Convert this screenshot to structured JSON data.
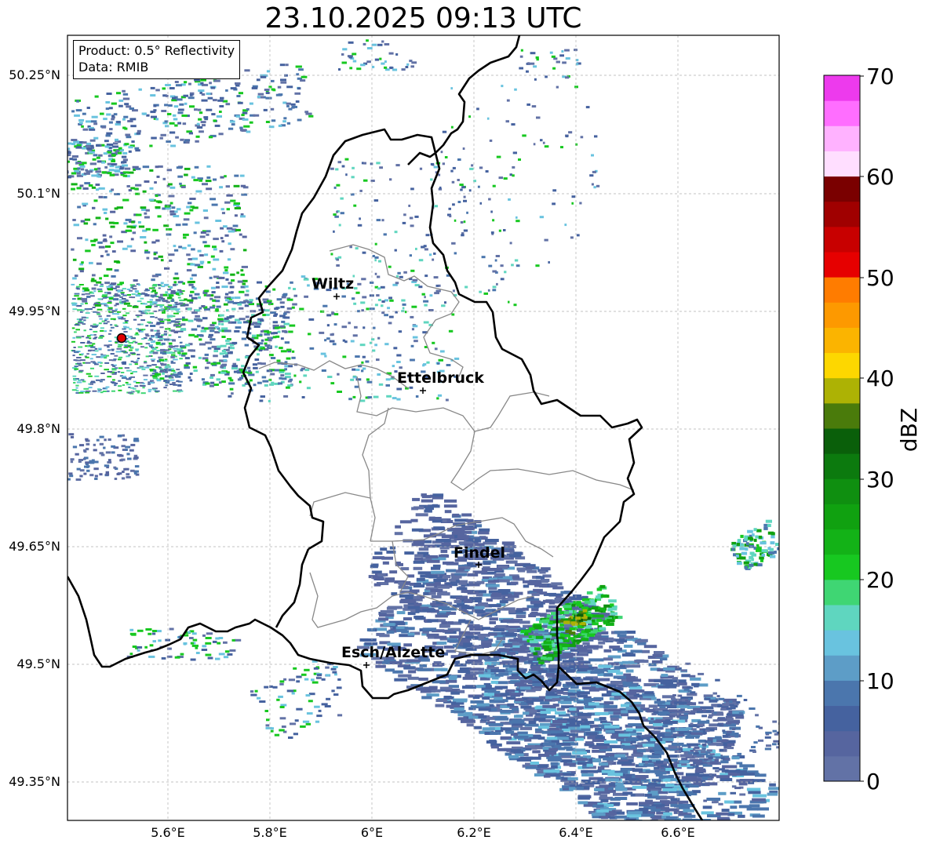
{
  "title": "23.10.2025 09:13 UTC",
  "info_box": {
    "product": "Product: 0.5° Reflectivity",
    "data": "Data: RMIB"
  },
  "map": {
    "lat_ticks": [
      "50.25°N",
      "50.1°N",
      "49.95°N",
      "49.8°N",
      "49.65°N",
      "49.5°N",
      "49.35°N"
    ],
    "lon_ticks": [
      "5.6°E",
      "5.8°E",
      "6°E",
      "6.2°E",
      "6.4°E",
      "6.6°E"
    ],
    "cities": [
      {
        "name": "Wiltz"
      },
      {
        "name": "Ettelbruck"
      },
      {
        "name": "Findel"
      },
      {
        "name": "Esch/Alzette"
      }
    ],
    "radar_site_color": "#e00000",
    "border_color": "#000000",
    "canton_color": "#808080"
  },
  "colorbar": {
    "label": "dBZ",
    "ticks": [
      "0",
      "10",
      "20",
      "30",
      "40",
      "50",
      "60",
      "70"
    ],
    "colors": [
      "#6272a6",
      "#56659f",
      "#45629f",
      "#4b76ad",
      "#5d9dc7",
      "#69c3df",
      "#5fd6bf",
      "#3fd673",
      "#17c820",
      "#13b217",
      "#10a110",
      "#0f8f10",
      "#0c7a0e",
      "#0a5f0a",
      "#4a7b0b",
      "#adb204",
      "#fdd700",
      "#fbb400",
      "#fd9900",
      "#ff7c00",
      "#e60000",
      "#c80000",
      "#a00000",
      "#7a0000",
      "#ffdeff",
      "#ffb2ff",
      "#ff6eff",
      "#ed3aed"
    ]
  }
}
